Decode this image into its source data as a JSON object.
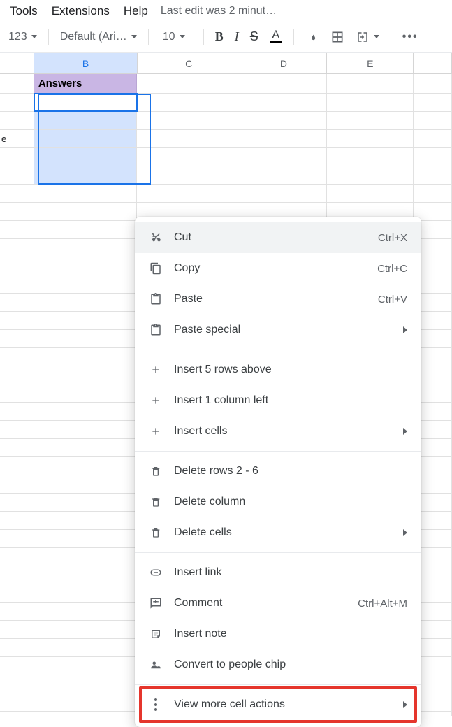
{
  "menubar": {
    "tools": "Tools",
    "extensions": "Extensions",
    "help": "Help",
    "last_edit": "Last edit was 2 minut…"
  },
  "toolbar": {
    "number_format": "123",
    "font_family": "Default (Ari…",
    "font_size": "10",
    "bold": "B",
    "italic": "I",
    "strike": "S",
    "text_color_letter": "A"
  },
  "grid": {
    "columns": {
      "B": "B",
      "C": "C",
      "D": "D",
      "E": "E"
    },
    "header_b1": "Answers",
    "partial_a_text": "e"
  },
  "context_menu": {
    "cut": {
      "label": "Cut",
      "shortcut": "Ctrl+X"
    },
    "copy": {
      "label": "Copy",
      "shortcut": "Ctrl+C"
    },
    "paste": {
      "label": "Paste",
      "shortcut": "Ctrl+V"
    },
    "paste_special": {
      "label": "Paste special"
    },
    "insert_rows": {
      "label": "Insert 5 rows above"
    },
    "insert_col": {
      "label": "Insert 1 column left"
    },
    "insert_cells": {
      "label": "Insert cells"
    },
    "delete_rows": {
      "label": "Delete rows 2 - 6"
    },
    "delete_col": {
      "label": "Delete column"
    },
    "delete_cells": {
      "label": "Delete cells"
    },
    "insert_link": {
      "label": "Insert link"
    },
    "comment": {
      "label": "Comment",
      "shortcut": "Ctrl+Alt+M"
    },
    "insert_note": {
      "label": "Insert note"
    },
    "people_chip": {
      "label": "Convert to people chip"
    },
    "more": {
      "label": "View more cell actions"
    }
  }
}
